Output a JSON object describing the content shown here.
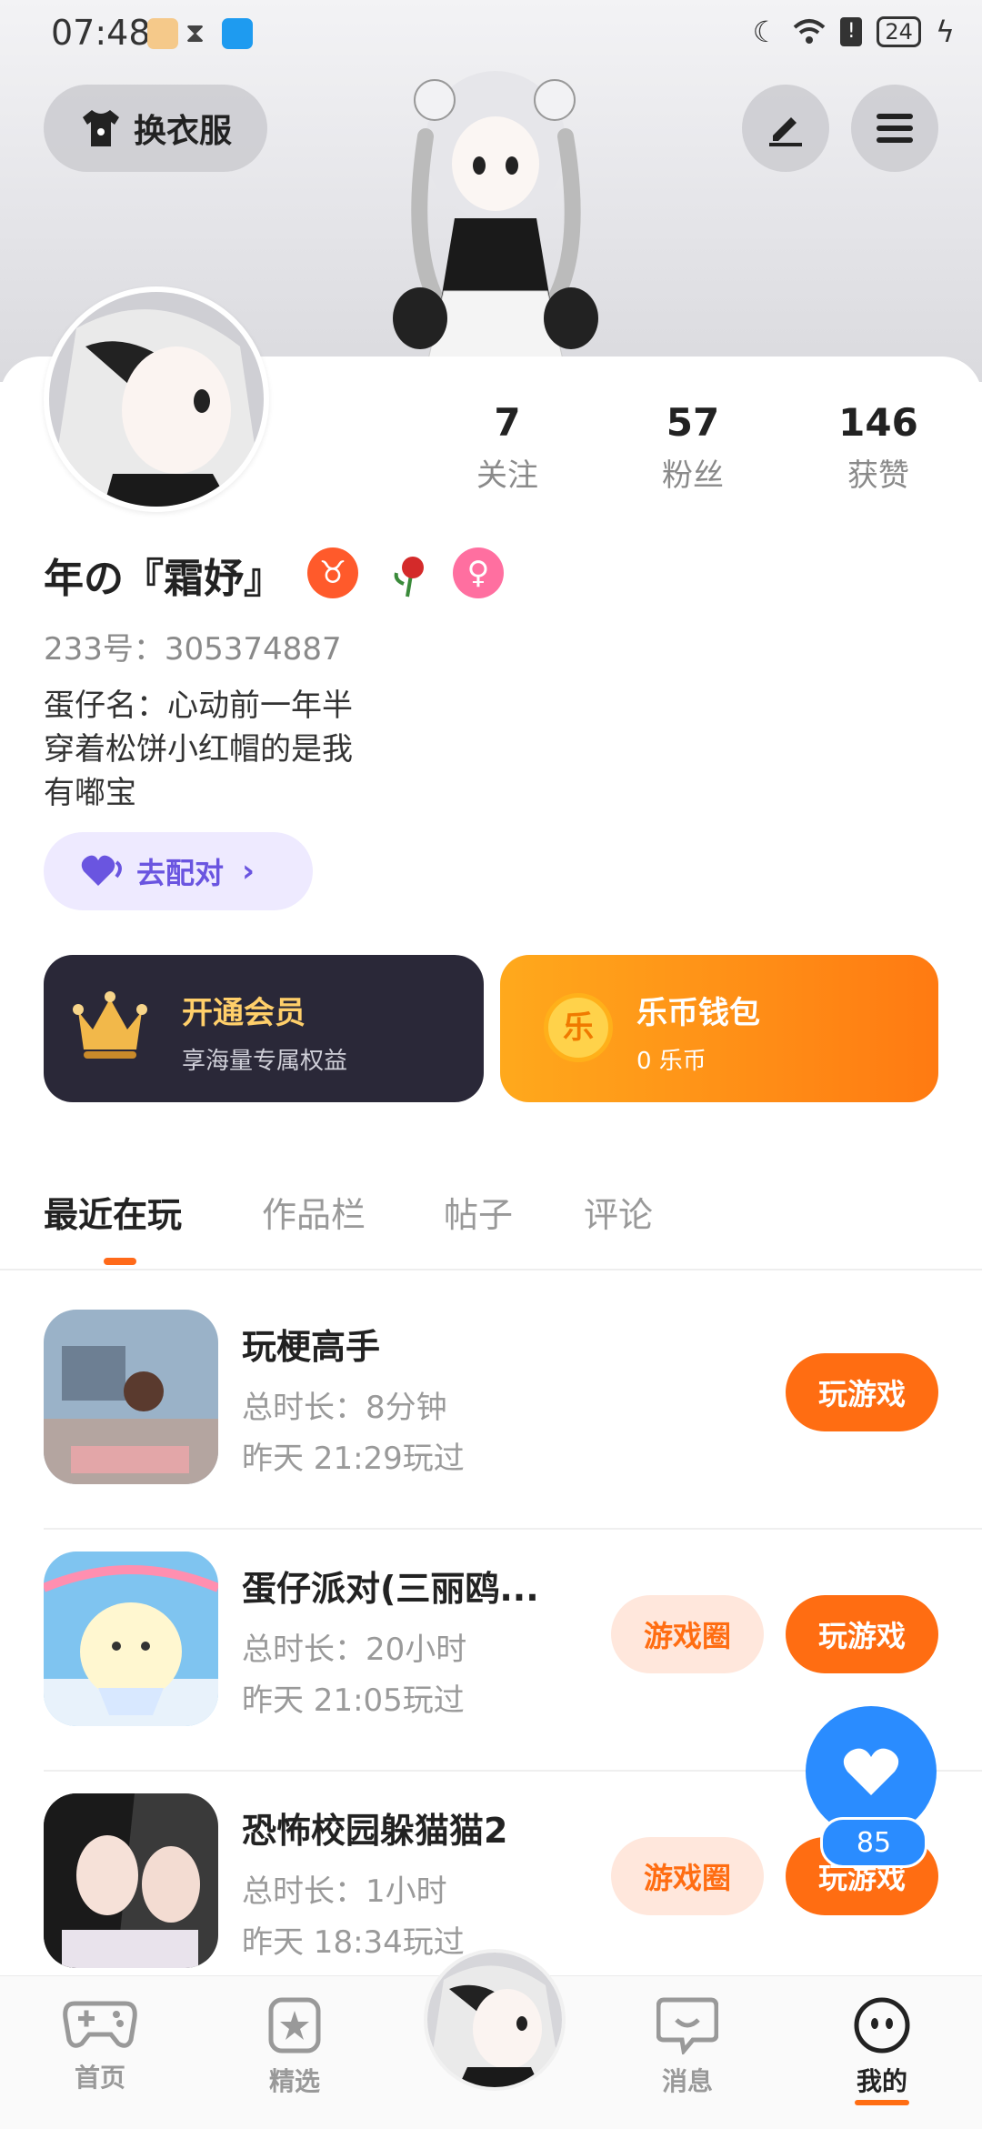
{
  "status_bar": {
    "time": "07:48",
    "battery": "24"
  },
  "header": {
    "outfit_label": "换衣服"
  },
  "profile": {
    "stats": [
      {
        "value": "7",
        "label": "关注"
      },
      {
        "value": "57",
        "label": "粉丝"
      },
      {
        "value": "146",
        "label": "获赞"
      }
    ],
    "nickname": "年の『霜妤』",
    "uid": "233号：305374887",
    "bio_lines": [
      "蛋仔名：心动前一年半",
      "穿着松饼小红帽的是我",
      "有嘟宝"
    ],
    "match_label": "去配对"
  },
  "vip": {
    "title": "开通会员",
    "subtitle": "享海量专属权益"
  },
  "wallet": {
    "title": "乐币钱包",
    "subtitle": "0 乐币",
    "coin_char": "乐"
  },
  "tabs": [
    "最近在玩",
    "作品栏",
    "帖子",
    "评论"
  ],
  "games": [
    {
      "name": "玩梗高手",
      "duration": "总时长：8分钟",
      "last_played": "昨天 21:29玩过",
      "circle_label": "",
      "play_label": "玩游戏"
    },
    {
      "name": "蛋仔派对(三丽鸥...",
      "duration": "总时长：20小时",
      "last_played": "昨天 21:05玩过",
      "circle_label": "游戏圈",
      "play_label": "玩游戏"
    },
    {
      "name": "恐怖校园躲猫猫2",
      "duration": "总时长：1小时",
      "last_played": "昨天 18:34玩过",
      "circle_label": "游戏圈",
      "play_label": "玩游戏"
    }
  ],
  "float": {
    "count": "85"
  },
  "nav": [
    {
      "label": "首页",
      "icon": "gamepad-icon"
    },
    {
      "label": "精选",
      "icon": "star-icon"
    },
    {
      "label": "消息",
      "icon": "chat-icon"
    },
    {
      "label": "我的",
      "icon": "face-icon"
    }
  ],
  "colors": {
    "accent": "#ff6d12",
    "vip_bg": "#2a2838",
    "like_blue": "#2a8cff"
  }
}
